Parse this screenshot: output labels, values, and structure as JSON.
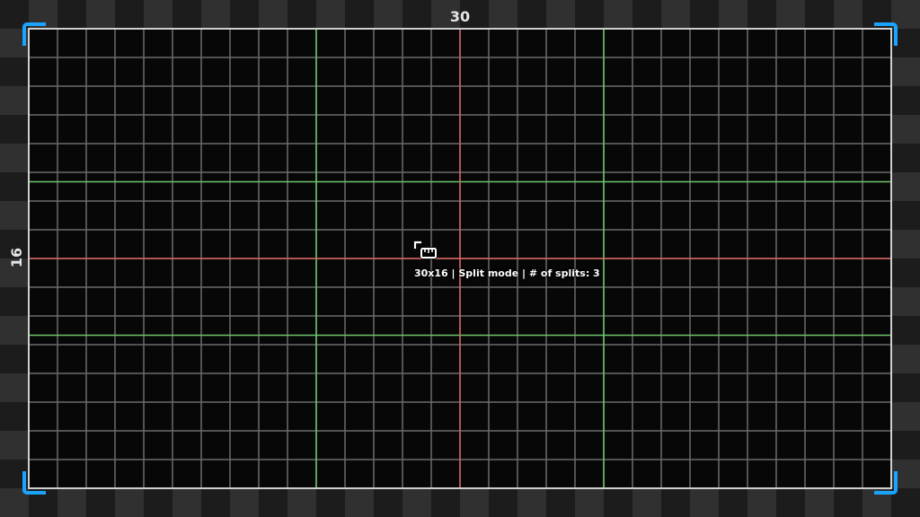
{
  "canvas": {
    "columns": 30,
    "rows": 16,
    "width_label": "30",
    "height_label": "16"
  },
  "status": {
    "text": "30x16 | Split mode | # of splits: 3"
  },
  "grid": {
    "background_color": "#070707",
    "line_color": "#6b6b6b",
    "border_color": "#cfcfcf",
    "center_split_color": "#d8615e",
    "split_color": "#6cc46a",
    "vertical_splits": [
      10,
      20
    ],
    "horizontal_splits": [
      5.33,
      10.67
    ]
  },
  "colors": {
    "corner_bracket": "#1aa3ff",
    "checker_light": "#303030",
    "checker_dark": "#1c1c1c"
  },
  "icons": {
    "corner_brackets": "corner-bracket-icon",
    "cursor": "ruler-cursor-icon"
  }
}
